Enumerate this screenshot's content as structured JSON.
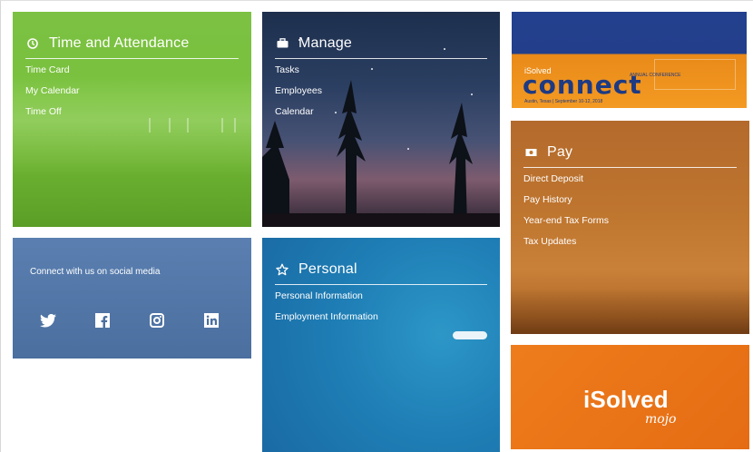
{
  "tiles": {
    "time": {
      "title": "Time and Attendance",
      "links": [
        "Time Card",
        "My Calendar",
        "Time Off"
      ],
      "icon": "clock-icon",
      "color": "#79c13d"
    },
    "manage": {
      "title": "Manage",
      "links": [
        "Tasks",
        "Employees",
        "Calendar"
      ],
      "icon": "briefcase-icon",
      "color": "#2b3f62"
    },
    "pay": {
      "title": "Pay",
      "links": [
        "Direct Deposit",
        "Pay History",
        "Year-end Tax Forms",
        "Tax Updates"
      ],
      "icon": "money-icon",
      "color": "#bf762f"
    },
    "personal": {
      "title": "Personal",
      "links": [
        "Personal Information",
        "Employment Information"
      ],
      "icon": "star-icon",
      "color": "#1f7fb6"
    },
    "social": {
      "label": "Connect with us on social media",
      "icons": [
        "twitter-icon",
        "facebook-icon",
        "instagram-icon",
        "linkedin-icon"
      ],
      "color": "#4b6f9f"
    },
    "connect_banner": {
      "brand_small": "iSolved",
      "brand_big": "connect",
      "subline": "ANNUAL CONFERENCE",
      "dateline": "Austin, Texas | September 10-12, 2018"
    },
    "mojo_banner": {
      "logo": "iSolved",
      "script": "mojo",
      "color": "#ee7c1c"
    }
  }
}
